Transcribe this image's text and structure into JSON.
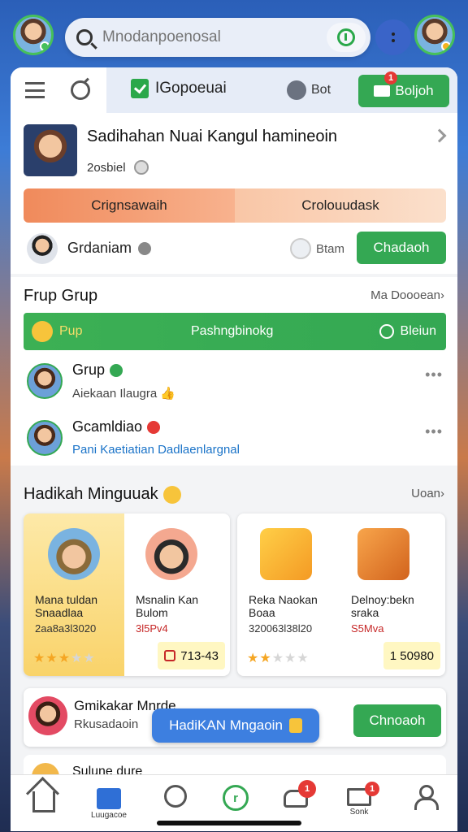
{
  "search": {
    "placeholder": "Mnodanpoenosal"
  },
  "tabs": {
    "title": "IGopoeuai",
    "bot_label": "Bot",
    "action_label": "Boljoh",
    "action_badge": "1"
  },
  "profile": {
    "title": "Sadihahan Nuai Kangul hamineoin",
    "subtitle": "2osbiel",
    "segments": [
      "Crignsawaih",
      "Crolouudask"
    ],
    "row_name": "Grdaniam",
    "row_status": "Btam",
    "row_button": "Chadaoh"
  },
  "groups": {
    "title": "Frup Grup",
    "link": "Ma Doooean",
    "bar_left": "Pup",
    "bar_center": "Pashngbinokg",
    "bar_right": "Bleiun",
    "items": [
      {
        "name": "Grup",
        "sub": "Aiekaan Ilaugra",
        "status": "green"
      },
      {
        "name": "Gcamldiao",
        "sub": "Pani Kaetiatian Dadlaenlargnal",
        "status": "red"
      }
    ]
  },
  "hadikah": {
    "title": "Hadikah Minguuak",
    "link": "Uoan",
    "cards": [
      {
        "left_name": "Mana tuldan Snaadlaa",
        "left_price": "2aa8a3l3020",
        "right_name": "Msnalin Kan Bulom",
        "right_price": "3l5Pv4",
        "rating": 3,
        "price": "713-43"
      },
      {
        "left_name": "Reka Naokan Boaa",
        "left_price": "320063l38l20",
        "right_name": "Delnoy:bekn sraka",
        "right_price": "S5Mva",
        "rating": 2,
        "price": "1 50980"
      }
    ]
  },
  "promo": {
    "title": "Gmikakar Mnrde",
    "subtitle": "Rkusadaoin",
    "toast": "HadiKAN Mngaoin",
    "button": "Chnoaoh"
  },
  "peek": {
    "title": "Sulune dure"
  },
  "nav": {
    "shop_label": "Luugacoe",
    "mail_label": "Sonk",
    "tray_badge": "1",
    "mail_badge": "1",
    "center_glyph": "r"
  },
  "colors": {
    "accent_green": "#34a853",
    "accent_blue": "#2f6fd6",
    "badge_red": "#e53935"
  }
}
